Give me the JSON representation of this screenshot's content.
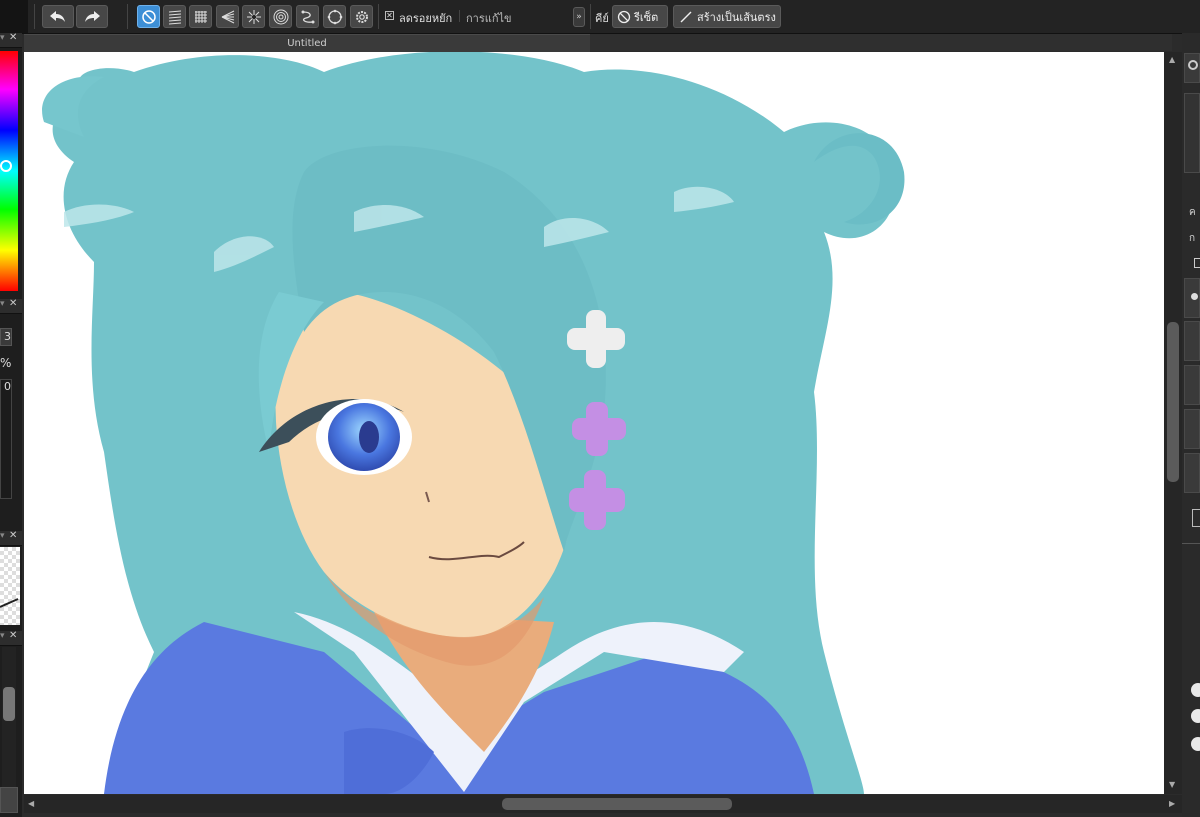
{
  "toolbar": {
    "undo": "undo-arrow",
    "redo": "redo-arrow",
    "ruler_tools": [
      "no-ruler",
      "parallel-lines",
      "grid",
      "perspective",
      "radial",
      "concentric",
      "curve",
      "ellipse",
      "settings"
    ],
    "antialias_label": "ลดรอยหยัก",
    "correction_label": "การแก้ไข",
    "key_label": "คีย์",
    "reset_label": "รีเซ็ต",
    "straight_line_label": "สร้างเป็นเส้นตรง"
  },
  "document": {
    "title": "Untitled"
  },
  "left_panel": {
    "value_1": "3",
    "value_2": "%",
    "value_3": "0"
  },
  "right_panel": {
    "char_1": "ค",
    "char_2": "ก"
  },
  "colors": {
    "accent": "#3d8fd6",
    "panel_bg": "#232323",
    "canvas_bg": "#ffffff",
    "hair": "#6fc4cc",
    "uniform": "#5a79dd"
  }
}
